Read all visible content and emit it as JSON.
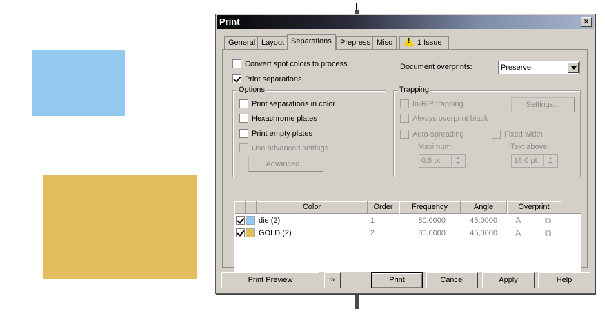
{
  "background": {
    "swatch_colors": {
      "blue": "#93c8ef",
      "gold": "#e3bd5e"
    }
  },
  "dialog": {
    "title": "Print",
    "close_glyph": "×",
    "tabs": [
      "General",
      "Layout",
      "Separations",
      "Prepress",
      "Misc",
      "1 Issue"
    ],
    "active_tab": "Separations",
    "issue_icon": "warning-icon",
    "separations": {
      "convert_spot": {
        "label": "Convert spot colors to process",
        "checked": false
      },
      "print_separations": {
        "label": "Print separations",
        "checked": true
      },
      "document_overprints": {
        "label": "Document overprints:",
        "value": "Preserve"
      },
      "options": {
        "legend": "Options",
        "in_color": {
          "label": "Print separations in color",
          "checked": false
        },
        "hexachrome": {
          "label": "Hexachrome plates",
          "checked": false
        },
        "empty_plates": {
          "label": "Print empty plates",
          "checked": false
        },
        "advanced_settings": {
          "label": "Use advanced settings",
          "checked": false,
          "enabled": false
        },
        "advanced_button": "Advanced..."
      },
      "trapping": {
        "legend": "Trapping",
        "in_rip": {
          "label": "In-RIP trapping",
          "enabled": false
        },
        "settings_button": "Settings...",
        "overprint_black": {
          "label": "Always overprint black",
          "enabled": false
        },
        "auto_spreading": {
          "label": "Auto-spreading",
          "enabled": false
        },
        "fixed_width": {
          "label": "Fixed width",
          "enabled": false
        },
        "maximum": {
          "label": "Maximum:",
          "value": "0,5 pt"
        },
        "text_above": {
          "label": "Text above:",
          "value": "18,0 pt"
        }
      },
      "plates": {
        "columns": [
          "Color",
          "Order",
          "Frequency",
          "Angle",
          "Overprint"
        ],
        "rows": [
          {
            "checked": true,
            "swatch": "#93c8ef",
            "name": "die (2)",
            "order": "1",
            "frequency": "80,0000",
            "angle": "45,0000",
            "overprint_icons": [
              "text-overprint-icon",
              "graphic-overprint-icon"
            ]
          },
          {
            "checked": true,
            "swatch": "#e3bd5e",
            "name": "GOLD (2)",
            "order": "2",
            "frequency": "80,0000",
            "angle": "45,0000",
            "overprint_icons": [
              "text-overprint-icon",
              "graphic-overprint-icon"
            ]
          }
        ]
      }
    },
    "footer": {
      "print_preview": "Print Preview",
      "expand_glyph": "»",
      "print": "Print",
      "cancel": "Cancel",
      "apply": "Apply",
      "help": "Help"
    }
  }
}
